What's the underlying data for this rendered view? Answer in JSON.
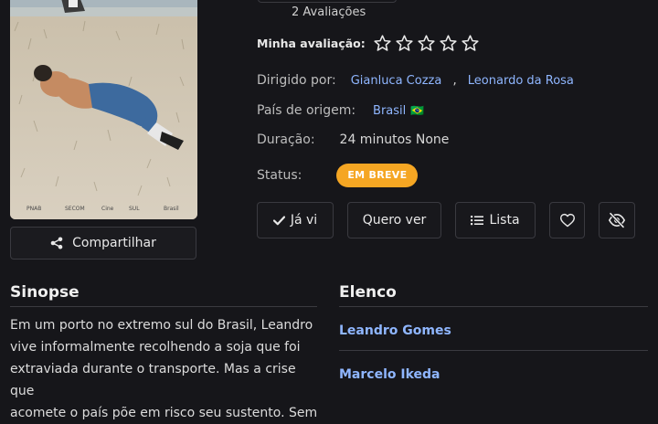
{
  "rating_summary": {
    "count_label": "2 Avaliações"
  },
  "my_rating": {
    "label": "Minha avaliação:",
    "stars": 0,
    "max_stars": 5
  },
  "details": {
    "directed_label": "Dirigido por:",
    "directors": [
      "Gianluca Cozza",
      "Leonardo da Rosa"
    ],
    "director_separator": ",",
    "country_label": "País de origem:",
    "country": "Brasil",
    "country_flag": "🇧🇷",
    "duration_label": "Duração:",
    "duration": "24 minutos None",
    "status_label": "Status:",
    "status": "EM BREVE"
  },
  "actions": {
    "seen_label": "Já vi",
    "want_label": "Quero ver",
    "list_label": "Lista",
    "share_label": "Compartilhar"
  },
  "synopsis": {
    "title": "Sinopse",
    "lines": [
      "Em um porto no extremo sul do Brasil, Leandro",
      "vive informalmente recolhendo a soja que foi",
      "extraviada durante o transporte. Mas a crise que",
      "acomete o país põe em risco seu sustento. Sem"
    ]
  },
  "cast": {
    "title": "Elenco",
    "members": [
      "Leandro Gomes",
      "Marcelo Ikeda"
    ]
  },
  "colors": {
    "accent_link": "#8fb6ff",
    "status_badge": "#f5a623",
    "background": "#16161a"
  }
}
